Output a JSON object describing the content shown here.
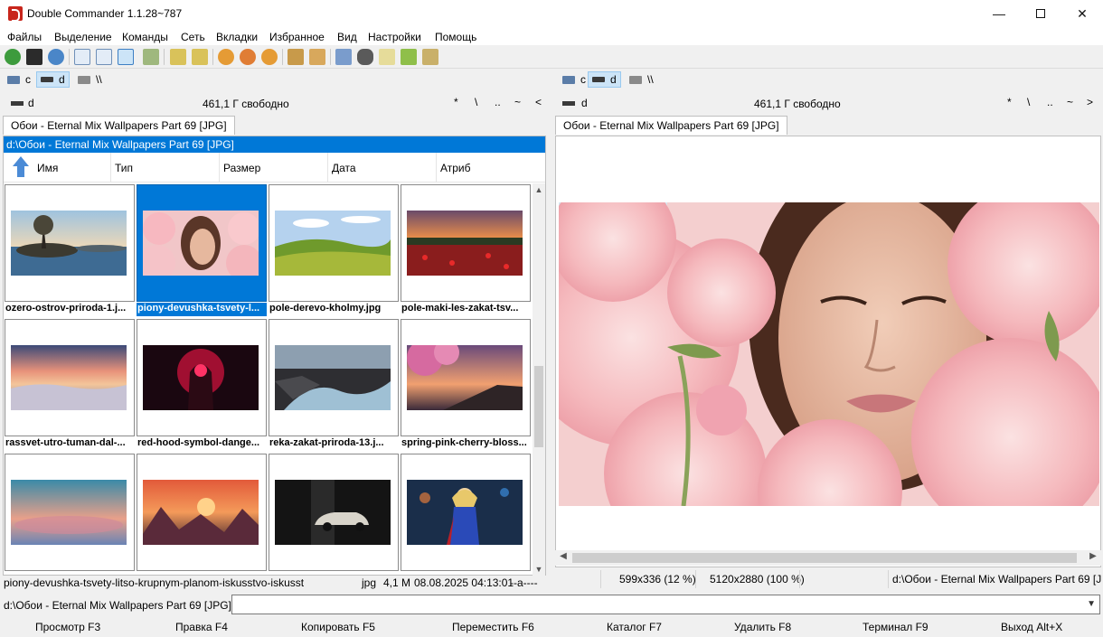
{
  "window": {
    "title": "Double Commander 1.1.28~787"
  },
  "menu": [
    "Файлы",
    "Выделение",
    "Команды",
    "Сеть",
    "Вкладки",
    "Избранное",
    "Вид",
    "Настройки",
    "Помощь"
  ],
  "drives": {
    "c": "c",
    "d": "d",
    "net": "\\\\"
  },
  "left": {
    "drive": "d",
    "free": "461,1 Г свободно",
    "nav": [
      "*",
      "\\",
      "..",
      "~",
      "<"
    ],
    "tab": "Обои - Eternal Mix Wallpapers Part 69 [JPG]",
    "path": "d:\\Обои - Eternal Mix Wallpapers Part 69 [JPG]",
    "columns": [
      "Имя",
      "Тип",
      "Размер",
      "Дата",
      "Атриб"
    ],
    "files": [
      "ozero-ostrov-priroda-1.j...",
      "piony-devushka-tsvety-l...",
      "pole-derevo-kholmy.jpg",
      "pole-maki-les-zakat-tsv...",
      "rassvet-utro-tuman-dal-...",
      "red-hood-symbol-dange...",
      "reka-zakat-priroda-13.j...",
      "spring-pink-cherry-bloss...",
      "",
      "",
      "",
      ""
    ],
    "status": {
      "name": "piony-devushka-tsvety-litso-krupnym-planom-iskusstvo-iskusst",
      "ext": "jpg",
      "size": "4,1 M",
      "date": "08.08.2025 04:13:01",
      "attr": "--a----"
    }
  },
  "right": {
    "drive": "d",
    "free": "461,1 Г свободно",
    "nav": [
      "*",
      "\\",
      "..",
      "~",
      ">"
    ],
    "tab": "Обои - Eternal Mix Wallpapers Part 69 [JPG]",
    "status": {
      "view": "599x336 (12 %)",
      "full": "5120x2880 (100 %)",
      "path": "d:\\Обои - Eternal Mix Wallpapers Part 69 [J"
    }
  },
  "cmdline": {
    "prompt": "d:\\Обои - Eternal Mix Wallpapers Part 69 [JPG]>"
  },
  "fkeys": [
    "Просмотр F3",
    "Правка F4",
    "Копировать F5",
    "Переместить F6",
    "Каталог F7",
    "Удалить F8",
    "Терминал F9",
    "Выход Alt+X"
  ],
  "icons": {
    "scroll_up": "▲",
    "scroll_down": "▼",
    "scroll_left": "◀",
    "scroll_right": "▶",
    "combo": "▼",
    "minimize": "—",
    "close": "✕"
  }
}
